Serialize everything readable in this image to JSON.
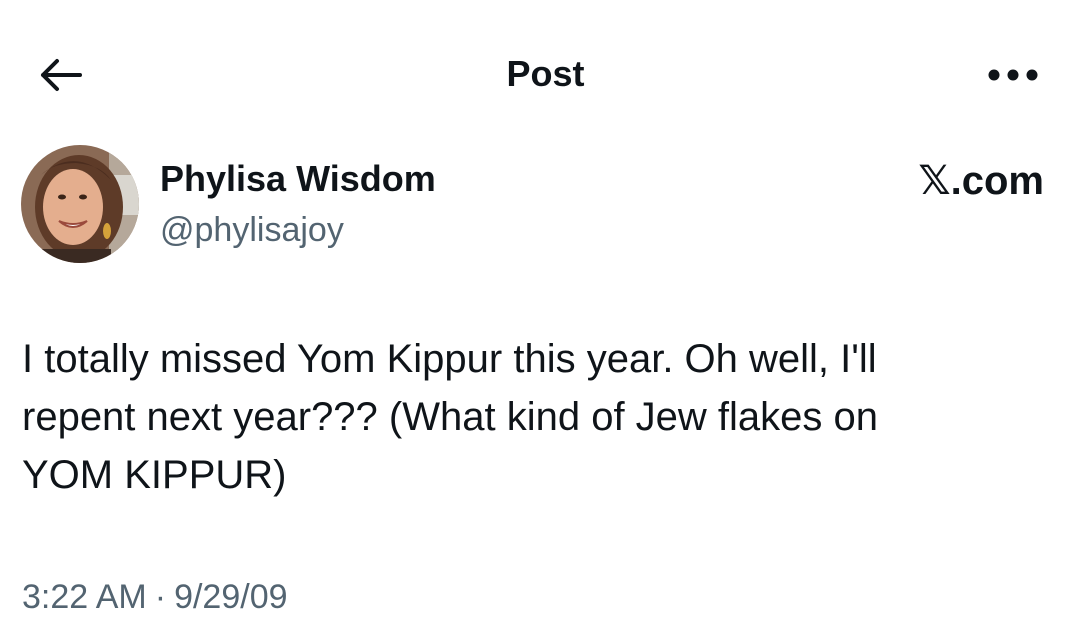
{
  "header": {
    "back_icon": "arrow-left-icon",
    "title": "Post",
    "more_icon": "more-horizontal-icon"
  },
  "author": {
    "display_name": "Phylisa Wisdom",
    "handle": "@phylisajoy"
  },
  "brand": {
    "logo_text": "𝕏",
    "domain_text": ".com"
  },
  "post": {
    "text_lines": [
      "I totally missed Yom Kippur this year. Oh well, I'll",
      "repent next year??? (What kind of Jew flakes on",
      "YOM KIPPUR)"
    ],
    "time": "3:22 AM",
    "separator": "·",
    "date": "9/29/09"
  },
  "colors": {
    "text_primary": "#0f1419",
    "text_secondary": "#536471",
    "background": "#ffffff"
  }
}
